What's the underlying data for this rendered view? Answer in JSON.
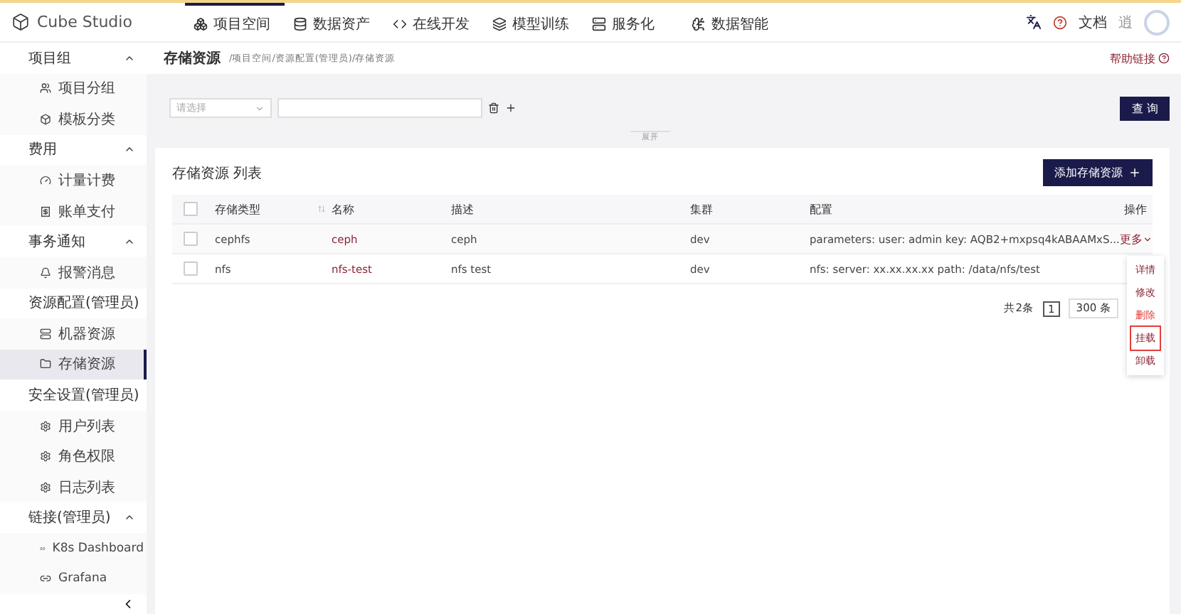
{
  "app": {
    "name": "Cube Studio"
  },
  "nav": [
    {
      "label": "项目空间",
      "selected": true
    },
    {
      "label": "数据资产",
      "selected": false
    },
    {
      "label": "在线开发",
      "selected": false
    },
    {
      "label": "模型训练",
      "selected": false
    },
    {
      "label": "服务化",
      "selected": false
    },
    {
      "label": "数据智能",
      "selected": false
    }
  ],
  "header_right": {
    "docs": "文档",
    "user": "逍"
  },
  "sidebar": [
    {
      "label": "项目组",
      "expanded": true,
      "children": [
        {
          "label": "项目分组",
          "selected": false
        },
        {
          "label": "模板分类",
          "selected": false
        }
      ]
    },
    {
      "label": "费用",
      "expanded": true,
      "children": [
        {
          "label": "计量计费",
          "selected": false
        },
        {
          "label": "账单支付",
          "selected": false
        }
      ]
    },
    {
      "label": "事务通知",
      "expanded": true,
      "children": [
        {
          "label": "报警消息",
          "selected": false
        }
      ]
    },
    {
      "label": "资源配置(管理员)",
      "expanded": true,
      "children": [
        {
          "label": "机器资源",
          "selected": false
        },
        {
          "label": "存储资源",
          "selected": true
        }
      ]
    },
    {
      "label": "安全设置(管理员)",
      "expanded": true,
      "children": [
        {
          "label": "用户列表",
          "selected": false
        },
        {
          "label": "角色权限",
          "selected": false
        },
        {
          "label": "日志列表",
          "selected": false
        }
      ]
    },
    {
      "label": "链接(管理员)",
      "expanded": true,
      "children": [
        {
          "label": "K8s Dashboard",
          "selected": false
        },
        {
          "label": "Grafana",
          "selected": false
        }
      ]
    }
  ],
  "page": {
    "title": "存储资源",
    "breadcrumb": "/项目空间/资源配置(管理员)/存储资源",
    "help": "帮助链接"
  },
  "filter": {
    "select_placeholder": "请选择",
    "query_button": "查 询",
    "toggle": "展开"
  },
  "table": {
    "title": "存储资源 列表",
    "add_button": "添加存储资源",
    "header_checked": false,
    "columns": [
      "存储类型",
      "名称",
      "描述",
      "集群",
      "配置",
      "操作"
    ],
    "rows": [
      {
        "checked": false,
        "type": "cephfs",
        "name": "ceph",
        "description": "ceph",
        "cluster": "dev",
        "config": "parameters: user: admin key: AQB2+mxpsq4kABAAMxS...",
        "action": "更多"
      },
      {
        "checked": false,
        "type": "nfs",
        "name": "nfs-test",
        "description": "nfs test",
        "cluster": "dev",
        "config": "nfs: server: xx.xx.xx.xx path: /data/nfs/test"
      }
    ]
  },
  "pagination": {
    "total": "共2条",
    "current_page": "1",
    "page_size": "300 条"
  },
  "action_menu": [
    {
      "label": "详情",
      "kind": "normal",
      "highlighted": false
    },
    {
      "label": "修改",
      "kind": "normal",
      "highlighted": false
    },
    {
      "label": "删除",
      "kind": "danger",
      "highlighted": false
    },
    {
      "label": "挂载",
      "kind": "normal",
      "highlighted": true
    },
    {
      "label": "卸载",
      "kind": "normal",
      "highlighted": false
    }
  ]
}
